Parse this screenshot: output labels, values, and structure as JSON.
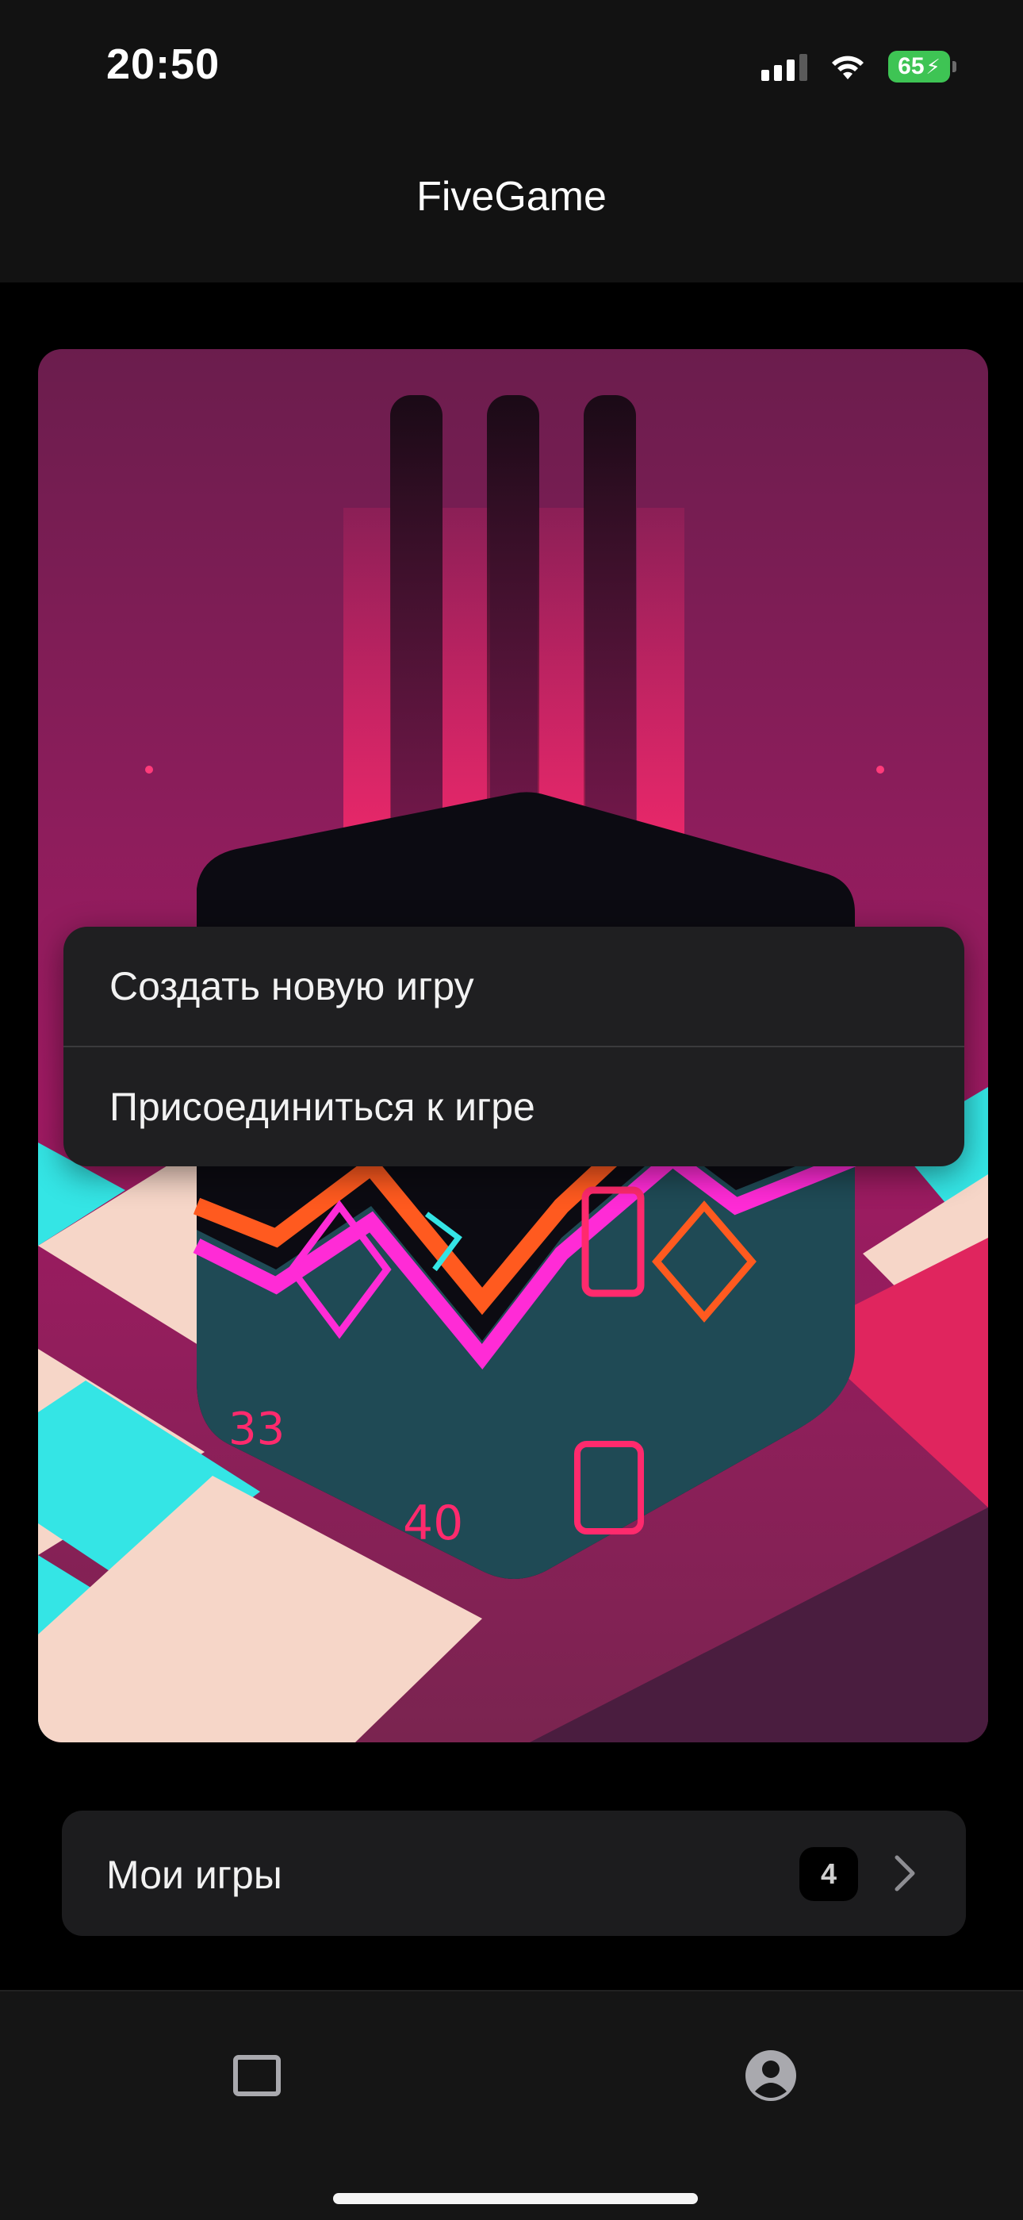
{
  "status_bar": {
    "time": "20:50",
    "battery": "65",
    "icons": [
      "signal-icon",
      "wifi-icon",
      "battery-charging-icon"
    ]
  },
  "nav": {
    "title": "FiveGame"
  },
  "hero": {
    "image": "dice-artwork"
  },
  "menu": {
    "items": [
      {
        "label": "Создать новую игру"
      },
      {
        "label": "Присоединиться к игре"
      }
    ]
  },
  "my_games": {
    "label": "Мои игры",
    "count": "4",
    "icon": "chevron-right-icon"
  },
  "tab_bar": {
    "tabs": [
      {
        "icon": "square-icon"
      },
      {
        "icon": "profile-icon"
      }
    ]
  },
  "colors": {
    "background": "#000000",
    "surface": "#1c1c1e",
    "battery": "#3ec454",
    "hero_magenta": "#a01a63",
    "accent_pink": "#ff2a6d",
    "accent_cyan": "#34e5e5"
  }
}
